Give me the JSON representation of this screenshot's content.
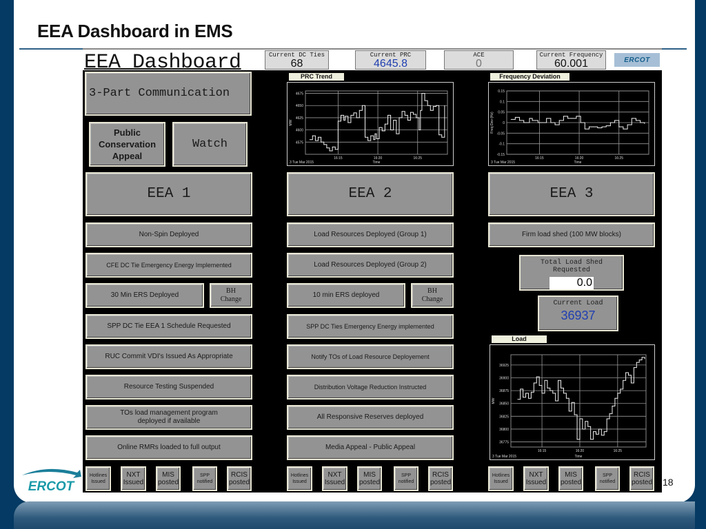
{
  "slide": {
    "title": "EEA Dashboard in EMS",
    "page_number": "18",
    "logo_text": "ERCOT"
  },
  "header": {
    "dashboard_title": "EEA Dashboard",
    "readouts": [
      {
        "label": "Current DC Ties",
        "value": "68",
        "color": "#111111"
      },
      {
        "label": "Current PRC",
        "value": "4645.8",
        "color": "#1f3fb0"
      },
      {
        "label": "ACE",
        "value": "0",
        "color": "#777777"
      },
      {
        "label": "Current Frequency",
        "value": "60.001",
        "color": "#111111"
      }
    ],
    "logo_text": "ERCOT"
  },
  "left_top": {
    "three_part": "3-Part Communication",
    "public_appeal": "Public Conservation Appeal",
    "watch": "Watch"
  },
  "columns": [
    {
      "heading": "EEA 1",
      "items": [
        "Non-Spin Deployed",
        "CFE DC Tie Emergency Energy Implemented",
        "30 Min ERS Deployed",
        "SPP DC Tie EEA 1 Schedule Requested",
        "RUC Commit VDI's Issued As Appropriate",
        "Resource Testing Suspended",
        "TOs load management program deployed if available",
        "Online RMRs loaded to full output"
      ],
      "bh_change": "BH Change"
    },
    {
      "heading": "EEA 2",
      "items": [
        "Load Resources Deployed (Group 1)",
        "Load Resources Deployed (Group 2)",
        "10 min ERS deployed",
        "SPP DC Ties Emergency Energy implemented",
        "Notify TOs of Load Resource Deployement",
        "Distribution Voltage Reduction Instructed",
        "All Responsive Reserves deployed",
        "Media Appeal - Public Appeal"
      ],
      "bh_change": "BH Change"
    },
    {
      "heading": "EEA 3",
      "items": [
        "Firm load shed (100 MW blocks)"
      ]
    }
  ],
  "load_shed": {
    "label": "Total Load Shed Requested",
    "value": "0.0"
  },
  "current_load": {
    "label": "Current Load",
    "value": "36937",
    "color": "#1f3fb0"
  },
  "status_buttons": [
    {
      "line1": "Hotlines",
      "line2": "Issued"
    },
    {
      "line1": "NXT",
      "line2": "Issued"
    },
    {
      "line1": "MIS",
      "line2": "posted"
    },
    {
      "line1": "SPP",
      "line2": "notified"
    },
    {
      "line1": "RCIS",
      "line2": "posted"
    }
  ],
  "chart_data": [
    {
      "type": "line",
      "title": "PRC Trend",
      "xlabel": "Time",
      "ylabel": "MW",
      "date_label": "3 Tue Mar 2015",
      "x_ticks": [
        "16:15",
        "16:20",
        "16:25"
      ],
      "y_ticks": [
        4575,
        4600,
        4625,
        4650,
        4675
      ],
      "ylim": [
        4550,
        4680
      ],
      "xlim": [
        0,
        1
      ],
      "grid": true,
      "series": [
        {
          "name": "PRC",
          "x": [
            0.03,
            0.05,
            0.07,
            0.09,
            0.11,
            0.13,
            0.15,
            0.17,
            0.19,
            0.21,
            0.23,
            0.25,
            0.27,
            0.28,
            0.3,
            0.32,
            0.34,
            0.36,
            0.38,
            0.4,
            0.42,
            0.44,
            0.46,
            0.48,
            0.49,
            0.5,
            0.52,
            0.54,
            0.56,
            0.58,
            0.6,
            0.62,
            0.64,
            0.66,
            0.68,
            0.7,
            0.72,
            0.74,
            0.76,
            0.78,
            0.8,
            0.81,
            0.82,
            0.84,
            0.86,
            0.88,
            0.9,
            0.92,
            0.94,
            0.96,
            0.98
          ],
          "values": [
            4580,
            4588,
            4578,
            4585,
            4575,
            4570,
            4563,
            4557,
            4565,
            4560,
            4618,
            4630,
            4620,
            4628,
            4615,
            4630,
            4635,
            4625,
            4640,
            4650,
            4585,
            4578,
            4588,
            4580,
            4592,
            4582,
            4605,
            4598,
            4612,
            4630,
            4600,
            4620,
            4592,
            4625,
            4638,
            4630,
            4620,
            4636,
            4632,
            4625,
            4600,
            4640,
            4675,
            4660,
            4650,
            4640,
            4648,
            4650,
            4590,
            4585,
            4650
          ]
        }
      ]
    },
    {
      "type": "line",
      "title": "Frequency Deviation",
      "xlabel": "Time",
      "ylabel": "Freq Dev (Hz)",
      "date_label": "3 Tue Mar 2015",
      "x_ticks": [
        "16:15",
        "16:20",
        "16:25"
      ],
      "y_ticks": [
        -0.15,
        -0.1,
        -0.05,
        0.0,
        0.05,
        0.1,
        0.15
      ],
      "ylim": [
        -0.15,
        0.15
      ],
      "xlim": [
        0,
        1
      ],
      "grid": true,
      "series": [
        {
          "name": "Freq Dev",
          "x": [
            0.03,
            0.06,
            0.09,
            0.12,
            0.14,
            0.16,
            0.18,
            0.2,
            0.22,
            0.25,
            0.28,
            0.31,
            0.34,
            0.37,
            0.4,
            0.43,
            0.46,
            0.49,
            0.52,
            0.55,
            0.58,
            0.61,
            0.64,
            0.67,
            0.7,
            0.73,
            0.76,
            0.79,
            0.82,
            0.85,
            0.88,
            0.91,
            0.94,
            0.97
          ],
          "values": [
            0.015,
            0.025,
            0.01,
            0.0,
            0.0,
            0.02,
            0.01,
            0.01,
            0.0,
            0.0,
            0.02,
            0.0,
            -0.01,
            0.01,
            0.03,
            0.02,
            0.02,
            0.03,
            0.0,
            -0.03,
            -0.02,
            -0.02,
            -0.025,
            -0.02,
            -0.015,
            0.0,
            0.01,
            -0.02,
            -0.03,
            -0.01,
            0.02,
            0.01,
            0.0,
            -0.005
          ]
        }
      ]
    },
    {
      "type": "line",
      "title": "Load",
      "xlabel": "Time",
      "ylabel": "MW",
      "date_label": "3 Tue Mar 2015",
      "x_ticks": [
        "16:15",
        "16:20",
        "16:25"
      ],
      "y_ticks": [
        36775,
        36800,
        36825,
        36850,
        36875,
        36900,
        36925
      ],
      "ylim": [
        36765,
        36945
      ],
      "xlim": [
        0,
        1
      ],
      "grid": true,
      "series": [
        {
          "name": "Load",
          "x": [
            0.05,
            0.07,
            0.09,
            0.11,
            0.13,
            0.15,
            0.17,
            0.19,
            0.21,
            0.23,
            0.25,
            0.27,
            0.29,
            0.31,
            0.33,
            0.35,
            0.37,
            0.39,
            0.41,
            0.43,
            0.45,
            0.47,
            0.49,
            0.51,
            0.53,
            0.55,
            0.57,
            0.59,
            0.61,
            0.63,
            0.65,
            0.67,
            0.69,
            0.71,
            0.73,
            0.75,
            0.77,
            0.79,
            0.81,
            0.83,
            0.85,
            0.87,
            0.89,
            0.91,
            0.93,
            0.95,
            0.97,
            0.99
          ],
          "values": [
            36858,
            36878,
            36862,
            36870,
            36860,
            36872,
            36890,
            36902,
            36885,
            36870,
            36895,
            36880,
            36875,
            36870,
            36855,
            36895,
            36880,
            36870,
            36860,
            36835,
            36852,
            36828,
            36780,
            36820,
            36800,
            36815,
            36805,
            36780,
            36795,
            36790,
            36800,
            36788,
            36795,
            36820,
            36830,
            36845,
            36860,
            36870,
            36878,
            36895,
            36910,
            36905,
            36890,
            36920,
            36930,
            36935,
            36940,
            36937
          ]
        }
      ]
    }
  ]
}
